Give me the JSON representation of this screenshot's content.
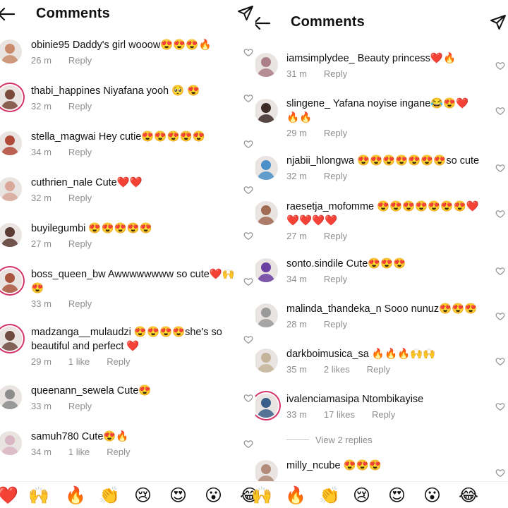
{
  "left": {
    "title": "Comments",
    "comments": [
      {
        "user": "obinie95",
        "text": "Daddy's girl wooow😍😍😍🔥",
        "time": "26 m",
        "likes": "",
        "reply": "Reply"
      },
      {
        "user": "thabi_happines",
        "text": "Niyafana yooh 🥺 😍",
        "time": "32 m",
        "likes": "",
        "reply": "Reply"
      },
      {
        "user": "stella_magwai",
        "text": "Hey cutie😍😍😍😍😍",
        "time": "34 m",
        "likes": "",
        "reply": "Reply"
      },
      {
        "user": "cuthrien_nale",
        "text": "Cute❤️❤️",
        "time": "32 m",
        "likes": "",
        "reply": "Reply"
      },
      {
        "user": "buyilegumbi",
        "text": "😍😍😍😍😍",
        "time": "27 m",
        "likes": "",
        "reply": "Reply"
      },
      {
        "user": "boss_queen_bw",
        "text": "Awwwwwwww so cute❤️🙌😍",
        "time": "33 m",
        "likes": "",
        "reply": "Reply"
      },
      {
        "user": "madzanga__mulaudzi",
        "text": "😍😍😍😍she's so beautiful and perfect ❤️",
        "time": "29 m",
        "likes": "1 like",
        "reply": "Reply"
      },
      {
        "user": "queenann_sewela",
        "text": "Cute😍",
        "time": "33 m",
        "likes": "",
        "reply": "Reply"
      },
      {
        "user": "samuh780",
        "text": "Cute😍🔥",
        "time": "34 m",
        "likes": "1 like",
        "reply": "Reply"
      }
    ]
  },
  "right": {
    "title": "Comments",
    "comments": [
      {
        "user": "iamsimplydee_",
        "text": "Beauty princess❤️🔥",
        "time": "31 m",
        "likes": "",
        "reply": "Reply"
      },
      {
        "user": "slingene_",
        "text": "Yafana noyise ingane😂😍❤️🔥🔥",
        "time": "29 m",
        "likes": "",
        "reply": "Reply"
      },
      {
        "user": "njabii_hlongwa",
        "text": "😍😍😍😍😍😍😍so cute",
        "time": "32 m",
        "likes": "",
        "reply": "Reply"
      },
      {
        "user": "raesetja_mofomme",
        "text": "😍😍😍😍😍😍😍❤️❤️❤️❤️❤️",
        "time": "27 m",
        "likes": "",
        "reply": "Reply"
      },
      {
        "user": "sonto.sindile",
        "text": "Cute😍😍😍",
        "time": "34 m",
        "likes": "",
        "reply": "Reply"
      },
      {
        "user": "malinda_thandeka_n",
        "text": "Sooo nunuz😍😍😍",
        "time": "28 m",
        "likes": "",
        "reply": "Reply"
      },
      {
        "user": "darkboimusica_sa",
        "text": "🔥🔥🔥🙌🙌",
        "time": "35 m",
        "likes": "2 likes",
        "reply": "Reply"
      },
      {
        "user": "ivalenciamasipa",
        "text": "Ntombikayise",
        "time": "33 m",
        "likes": "17 likes",
        "reply": "Reply"
      },
      {
        "user": "milly_ncube",
        "text": "😍😍😍",
        "time": "",
        "likes": "",
        "reply": ""
      }
    ],
    "view_replies": "View 2 replies"
  },
  "emoji_bar": [
    "❤️",
    "🙌",
    "🔥",
    "👏",
    "😢",
    "😍",
    "😮",
    "😂",
    "🙌",
    "🔥",
    "👏",
    "😢",
    "😍",
    "😮",
    "😂"
  ],
  "colors": {
    "text": "#111111",
    "meta": "#8e8e8e",
    "story_ring": "#d3346a",
    "background": "#ffffff"
  },
  "icons": {
    "back": "back-arrow-icon",
    "send": "send-icon",
    "like": "heart-outline-icon"
  }
}
